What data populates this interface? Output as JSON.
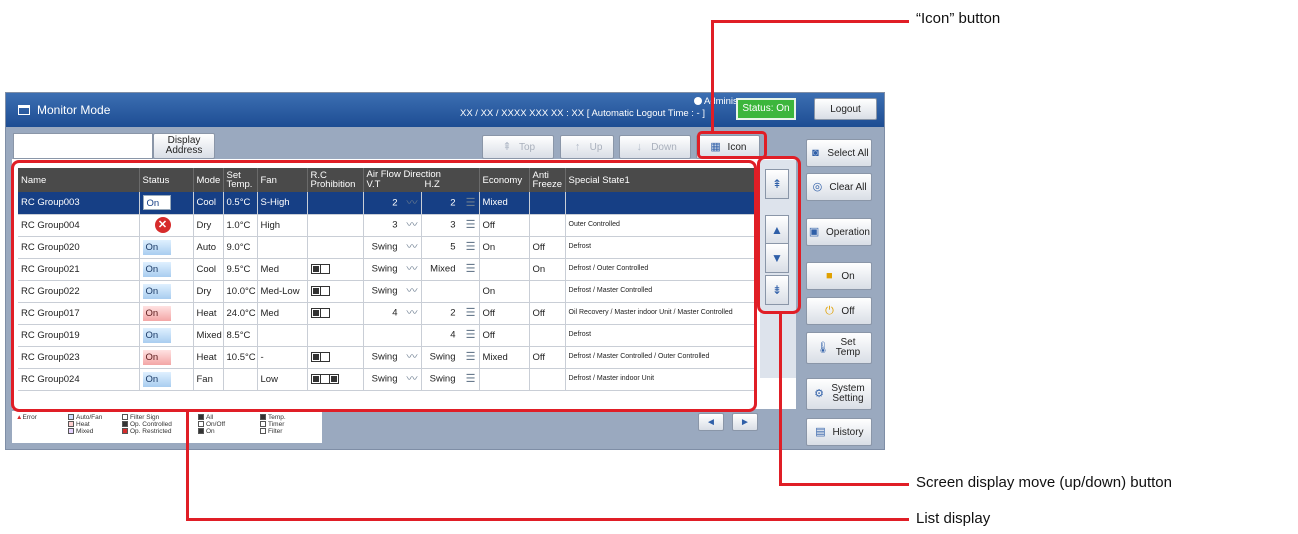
{
  "window": {
    "title": "Monitor Mode",
    "admin": "Administrator",
    "datetime": "XX / XX / XXXX  XXX   XX : XX    [ Automatic Logout Time : - ]",
    "status_badge": "Status: On"
  },
  "toolbar": {
    "display_address": "Display Address",
    "top": "Top",
    "up": "Up",
    "down": "Down",
    "icon": "Icon"
  },
  "right_panel": {
    "logout": "Logout",
    "select_all": "Select All",
    "clear_all": "Clear All",
    "operation": "Operation",
    "on": "On",
    "off": "Off",
    "set_temp": "Set Temp",
    "system_setting": "System Setting",
    "history": "History"
  },
  "table": {
    "headers": {
      "name": "Name",
      "status": "Status",
      "mode": "Mode",
      "set_temp": "Set Temp.",
      "fan": "Fan",
      "rc_prohibition": "R.C Prohibition",
      "air_flow": "Air Flow Direction",
      "vt": "V.T",
      "hz": "H.Z",
      "economy": "Economy",
      "anti_freeze": "Anti Freeze",
      "special": "Special State1"
    },
    "rows": [
      {
        "name": "RC Group003",
        "status": "On",
        "mode": "Cool",
        "temp": "0.5°C",
        "fan": "S-High",
        "vt": "2",
        "hz": "2",
        "economy": "Mixed",
        "anti": "",
        "special": ""
      },
      {
        "name": "RC Group004",
        "status": "",
        "mode": "Dry",
        "temp": "1.0°C",
        "fan": "High",
        "vt": "3",
        "hz": "3",
        "economy": "Off",
        "anti": "",
        "special": "Outer Controlled"
      },
      {
        "name": "RC Group020",
        "status": "On",
        "mode": "Auto",
        "temp": "9.0°C",
        "fan": "",
        "vt": "Swing",
        "hz": "5",
        "economy": "On",
        "anti": "Off",
        "special": "Defrost"
      },
      {
        "name": "RC Group021",
        "status": "On",
        "mode": "Cool",
        "temp": "9.5°C",
        "fan": "Med",
        "vt": "Swing",
        "hz": "Mixed",
        "economy": "",
        "anti": "On",
        "special": "Defrost / Outer Controlled"
      },
      {
        "name": "RC Group022",
        "status": "On",
        "mode": "Dry",
        "temp": "10.0°C",
        "fan": "Med-Low",
        "vt": "Swing",
        "hz": "",
        "economy": "On",
        "anti": "",
        "special": "Defrost / Master Controlled"
      },
      {
        "name": "RC Group017",
        "status": "On",
        "mode": "Heat",
        "temp": "24.0°C",
        "fan": "Med",
        "vt": "4",
        "hz": "2",
        "economy": "Off",
        "anti": "Off",
        "special": "Oil Recovery / Master indoor Unit / Master Controlled"
      },
      {
        "name": "RC Group019",
        "status": "On",
        "mode": "Mixed",
        "temp": "8.5°C",
        "fan": "",
        "vt": "",
        "hz": "4",
        "economy": "Off",
        "anti": "",
        "special": "Defrost"
      },
      {
        "name": "RC Group023",
        "status": "On",
        "mode": "Heat",
        "temp": "10.5°C",
        "fan": "-",
        "vt": "Swing",
        "hz": "Swing",
        "economy": "Mixed",
        "anti": "Off",
        "special": "Defrost / Master Controlled / Outer Controlled"
      },
      {
        "name": "RC Group024",
        "status": "On",
        "mode": "Fan",
        "temp": "",
        "fan": "Low",
        "vt": "Swing",
        "hz": "Swing",
        "economy": "",
        "anti": "",
        "special": "Defrost / Master indoor Unit"
      }
    ]
  },
  "legend": {
    "error": "Error",
    "auto_fan": "Auto/Fan",
    "heat": "Heat",
    "mixed": "Mixed",
    "filter_sign": "Filter Sign",
    "op_controlled": "Op. Controlled",
    "op_restricted": "Op. Restricted",
    "all": "All",
    "on_off": "On/Off",
    "on": "On",
    "temp": "Temp.",
    "timer": "Timer",
    "filter": "Filter"
  },
  "callouts": {
    "icon_button": "“Icon” button",
    "scroll_buttons": "Screen display move (up/down) button",
    "list_display": "List display"
  },
  "colors": {
    "highlight": "#e01e26",
    "titlebar": "#1d4d93",
    "status_on": "#3cb63c",
    "selected_row": "#163f85"
  }
}
